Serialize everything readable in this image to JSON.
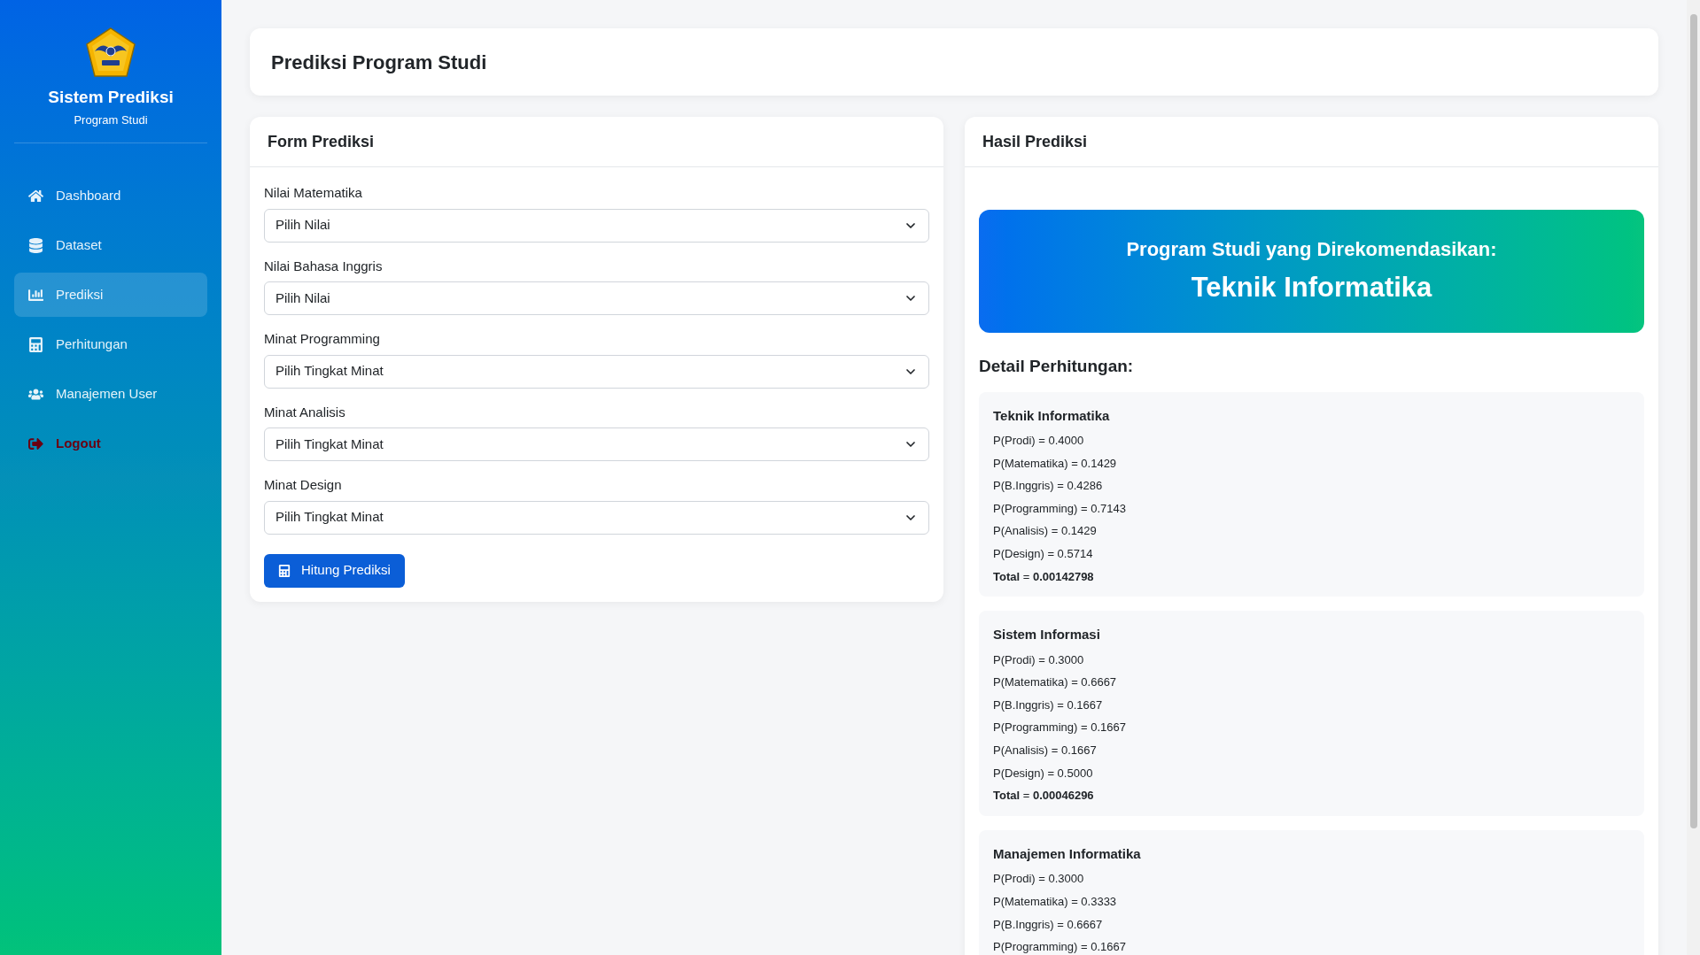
{
  "sidebar": {
    "title": "Sistem Prediksi",
    "subtitle": "Program Studi",
    "items": [
      {
        "label": "Dashboard",
        "kind": "home",
        "selected": false
      },
      {
        "label": "Dataset",
        "kind": "database",
        "selected": false
      },
      {
        "label": "Prediksi",
        "kind": "chart",
        "selected": true
      },
      {
        "label": "Perhitungan",
        "kind": "calculator",
        "selected": false
      },
      {
        "label": "Manajemen User",
        "kind": "users",
        "selected": false
      },
      {
        "label": "Logout",
        "kind": "logout",
        "selected": false
      }
    ]
  },
  "page_title": "Prediksi Program Studi",
  "form": {
    "title": "Form Prediksi",
    "fields": [
      {
        "label": "Nilai Matematika",
        "placeholder": "Pilih Nilai"
      },
      {
        "label": "Nilai Bahasa Inggris",
        "placeholder": "Pilih Nilai"
      },
      {
        "label": "Minat Programming",
        "placeholder": "Pilih Tingkat Minat"
      },
      {
        "label": "Minat Analisis",
        "placeholder": "Pilih Tingkat Minat"
      },
      {
        "label": "Minat Design",
        "placeholder": "Pilih Tingkat Minat"
      }
    ],
    "button": "Hitung Prediksi"
  },
  "result": {
    "title": "Hasil Prediksi",
    "banner_caption": "Program Studi yang Direkomendasikan:",
    "recommendation": "Teknik Informatika",
    "detail_title": "Detail Perhitungan:",
    "details": [
      {
        "name": "Teknik Informatika",
        "lines": [
          "P(Prodi) = 0.4000",
          "P(Matematika) = 0.1429",
          "P(B.Inggris) = 0.4286",
          "P(Programming) = 0.7143",
          "P(Analisis) = 0.1429",
          "P(Design) = 0.5714",
          "**Total** = **0.00142798**"
        ]
      },
      {
        "name": "Sistem Informasi",
        "lines": [
          "P(Prodi) = 0.3000",
          "P(Matematika) = 0.6667",
          "P(B.Inggris) = 0.1667",
          "P(Programming) = 0.1667",
          "P(Analisis) = 0.1667",
          "P(Design) = 0.5000",
          "**Total** = **0.00046296**"
        ]
      },
      {
        "name": "Manajemen Informatika",
        "lines": [
          "P(Prodi) = 0.3000",
          "P(Matematika) = 0.3333",
          "P(B.Inggris) = 0.6667",
          "P(Programming) = 0.1667"
        ]
      }
    ]
  }
}
